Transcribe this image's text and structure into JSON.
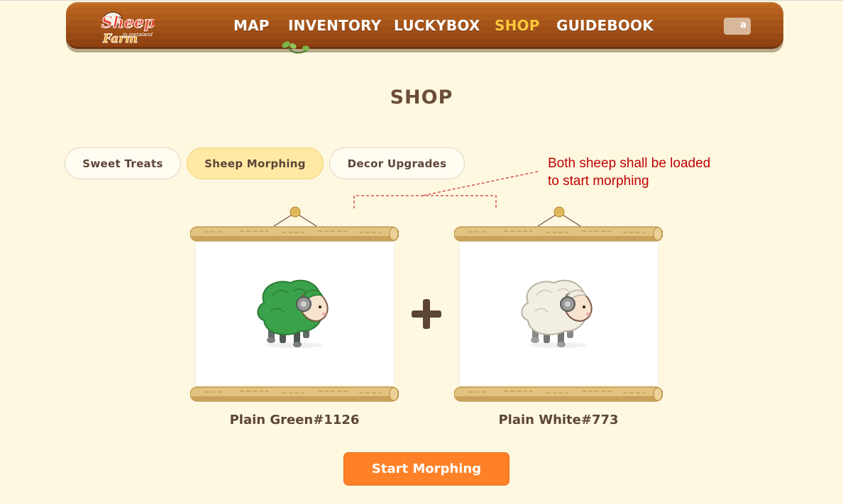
{
  "header": {
    "logo_text": {
      "line1": "Sheep",
      "line2": "in Metaland",
      "line3": "Farm"
    },
    "nav": [
      {
        "label": "MAP"
      },
      {
        "label": "INVENTORY"
      },
      {
        "label": "LUCKYBOX"
      },
      {
        "label": "SHOP",
        "active": true
      },
      {
        "label": "GUIDEBOOK"
      }
    ],
    "wallet_glyph": "a"
  },
  "page": {
    "title": "SHOP"
  },
  "tabs": [
    {
      "label": "Sweet Treats"
    },
    {
      "label": "Sheep Morphing",
      "active": true
    },
    {
      "label": "Decor Upgrades"
    }
  ],
  "annotation": {
    "line1": "Both sheep shall be loaded",
    "line2": "to start morphing"
  },
  "slots": [
    {
      "name": "Plain Green#1126",
      "wool_color": "#3aa24a"
    },
    {
      "name": "Plain White#773",
      "wool_color": "#f2eee2"
    }
  ],
  "action": {
    "label": "Start Morphing"
  },
  "colors": {
    "background": "#fff8e1",
    "active_nav": "#ffc83a",
    "active_tab": "#ffe9a3",
    "primary_button": "#ff8127",
    "annotation": "#c00000",
    "text_dark": "#5c4536"
  }
}
